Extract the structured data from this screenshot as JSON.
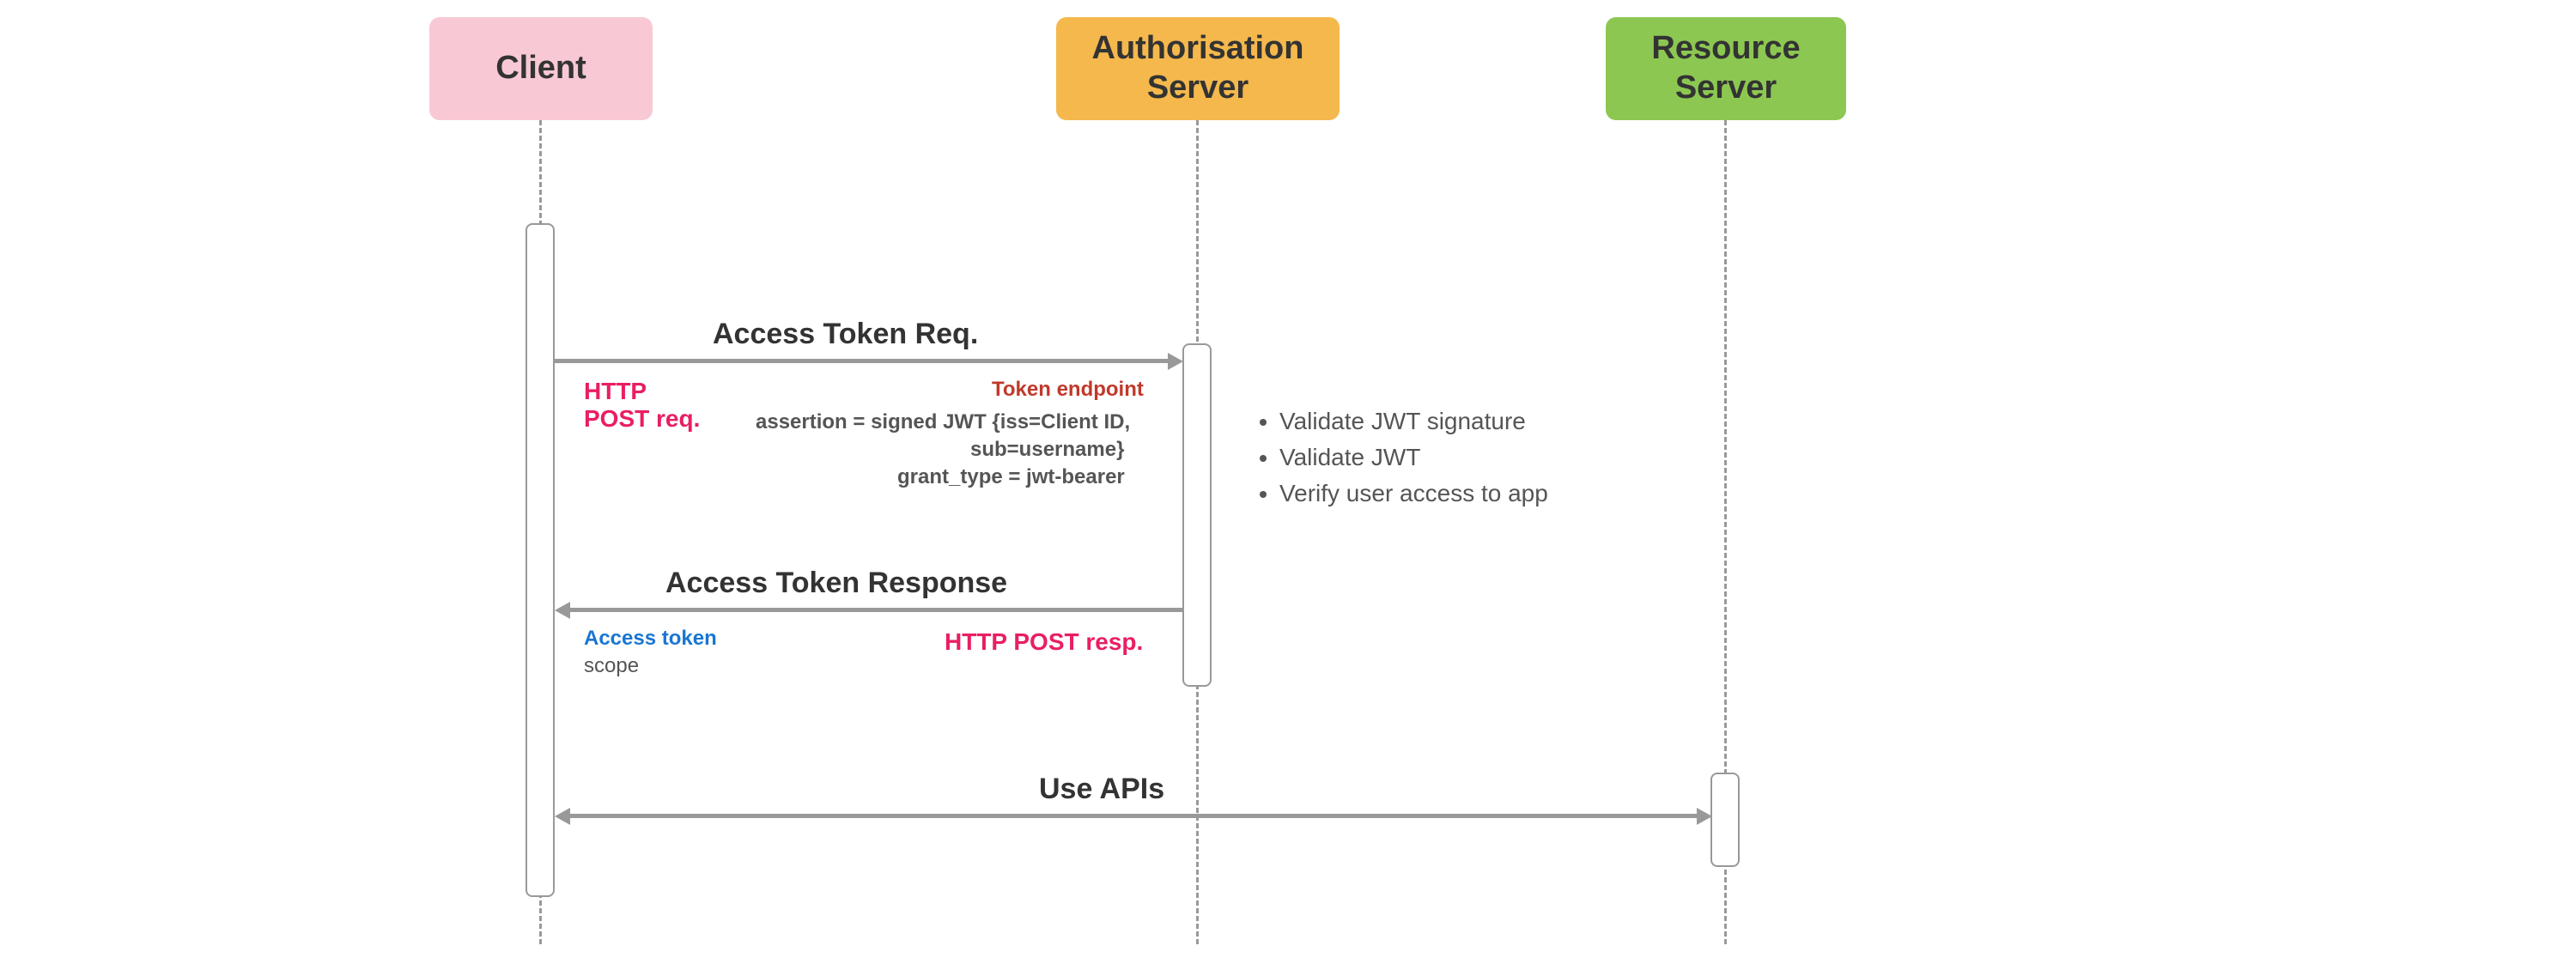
{
  "participants": {
    "client": "Client",
    "auth": "Authorisation\nServer",
    "resource": "Resource\nServer"
  },
  "messages": {
    "req_title": "Access Token Req.",
    "req_http": "HTTP\nPOST req.",
    "req_endpoint": "Token endpoint",
    "req_assertion1": "assertion =  signed JWT {iss=Client ID,",
    "req_assertion2": "sub=username}",
    "req_grant": "grant_type = jwt-bearer",
    "validate": {
      "v1": "Validate JWT signature",
      "v2": "Validate JWT",
      "v3": "Verify user access to app"
    },
    "resp_title": "Access Token Response",
    "resp_http": "HTTP POST resp.",
    "resp_token": "Access token",
    "resp_scope": "scope",
    "use_apis": "Use APIs"
  }
}
